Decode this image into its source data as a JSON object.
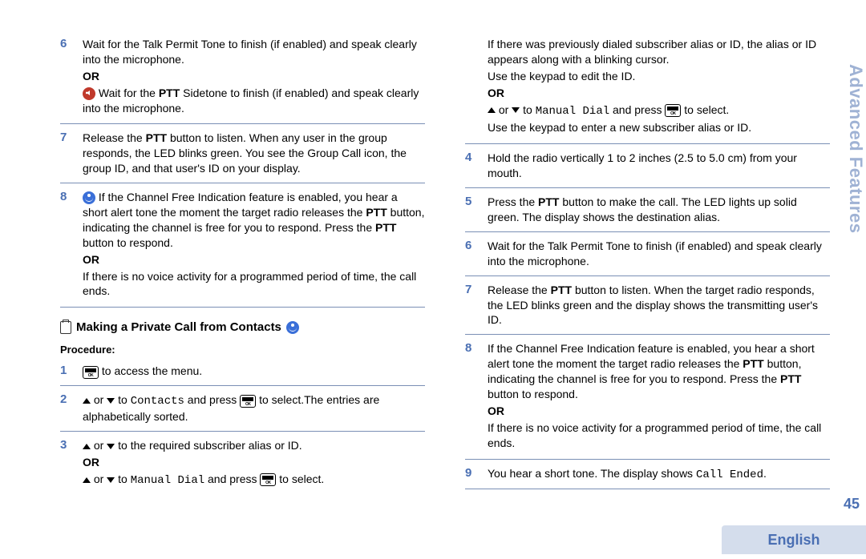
{
  "sideTab": "Advanced Features",
  "pageNum": "45",
  "language": "English",
  "section": {
    "title": "Making a Private Call from Contacts",
    "procedureLabel": "Procedure:"
  },
  "left": {
    "s6_a": "Wait for the Talk Permit Tone to finish (if enabled) and speak clearly into the microphone.",
    "s6_or": "OR",
    "s6_b1": " Wait for the ",
    "s6_b2": "PTT",
    "s6_b3": " Sidetone to finish (if enabled) and speak clearly into the microphone.",
    "s7_a": "Release the ",
    "s7_b": "PTT",
    "s7_c": " button to listen. When any user in the group responds, the LED blinks green. You see the Group Call icon, the group ID, and that user's ID on your display.",
    "s8_a": " If the Channel Free Indication feature is enabled, you hear a short alert tone the moment the target radio releases the ",
    "s8_b": "PTT",
    "s8_c": " button, indicating the channel is free for you to respond. Press the ",
    "s8_d": "PTT",
    "s8_e": " button to respond.",
    "s8_or": "OR",
    "s8_f": "If there is no voice activity for a programmed period of time, the call ends.",
    "p1": " to access the menu.",
    "p2_a": " or ",
    "p2_b": " to ",
    "p2_contacts": "Contacts",
    "p2_c": " and press ",
    "p2_d": " to select.The entries are alphabetically sorted.",
    "p3_a": " or ",
    "p3_b": " to the required subscriber alias or ID.",
    "p3_or": "OR",
    "p3_c": " or ",
    "p3_d": " to ",
    "p3_manual": "Manual Dial",
    "p3_e": " and press ",
    "p3_f": " to select."
  },
  "right": {
    "r3_a": "If there was previously dialed subscriber alias or ID, the alias or ID appears along with a blinking cursor.",
    "r3_b": "Use the keypad to edit the ID.",
    "r3_or": "OR",
    "r3_c": " or ",
    "r3_d": " to ",
    "r3_manual": "Manual Dial",
    "r3_e": " and press ",
    "r3_f": " to select.",
    "r3_g": "Use the keypad to enter a new subscriber alias or ID.",
    "r4": "Hold the radio vertically 1 to 2 inches (2.5 to 5.0 cm) from your mouth.",
    "r5_a": "Press the ",
    "r5_b": "PTT",
    "r5_c": " button to make the call. The LED lights up solid green. The display shows the destination alias.",
    "r6": "Wait for the Talk Permit Tone to finish (if enabled) and speak clearly into the microphone.",
    "r7_a": "Release the ",
    "r7_b": "PTT",
    "r7_c": " button to listen. When the target radio responds, the LED blinks green and the display shows the transmitting user's ID.",
    "r8_a": "If the Channel Free Indication feature is enabled, you hear a short alert tone the moment the target radio releases the ",
    "r8_b": "PTT",
    "r8_c": " button, indicating the channel is free for you to respond. Press the ",
    "r8_d": "PTT",
    "r8_e": " button to respond.",
    "r8_or": "OR",
    "r8_f": "If there is no voice activity for a programmed period of time, the call ends.",
    "r9_a": "You hear a short tone. The display shows ",
    "r9_b": "Call Ended",
    "r9_c": "."
  },
  "nums": {
    "n6": "6",
    "n7": "7",
    "n8": "8",
    "p1": "1",
    "p2": "2",
    "p3": "3",
    "r4": "4",
    "r5": "5",
    "r6": "6",
    "r7": "7",
    "r8": "8",
    "r9": "9"
  }
}
